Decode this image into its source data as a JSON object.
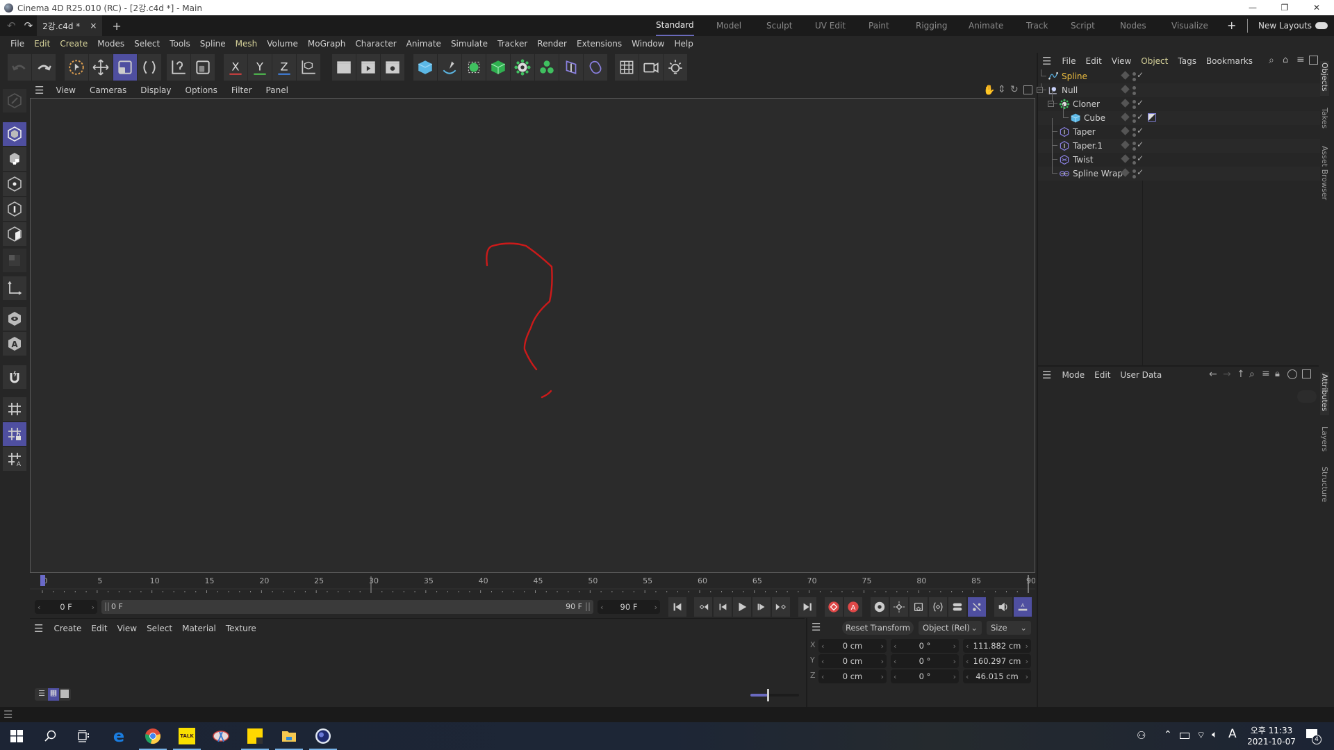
{
  "window": {
    "title": "Cinema 4D R25.010 (RC) - [2강.c4d *] - Main",
    "controls": {
      "minimize": "—",
      "maximize": "❐",
      "close": "✕"
    }
  },
  "tabbar": {
    "undo_icon": "undo-icon",
    "redo_icon": "redo-icon",
    "doc_tab": "2강.c4d *",
    "close": "×",
    "add": "+",
    "layouts": [
      "Standard",
      "Model",
      "Sculpt",
      "UV Edit",
      "Paint",
      "Rigging",
      "Animate",
      "Track",
      "Script",
      "Nodes",
      "Visualize"
    ],
    "active_layout": "Standard",
    "add_layout": "+",
    "new_layouts_label": "New Layouts"
  },
  "menubar": {
    "items": [
      "File",
      "Edit",
      "Create",
      "Modes",
      "Select",
      "Tools",
      "Spline",
      "Mesh",
      "Volume",
      "MoGraph",
      "Character",
      "Animate",
      "Simulate",
      "Tracker",
      "Render",
      "Extensions",
      "Window",
      "Help"
    ]
  },
  "toolbar": {
    "tools": [
      "undo",
      "redo",
      "live-selection",
      "move",
      "scale",
      "rotate",
      "transform-recent",
      "transform",
      "lock-x",
      "lock-y",
      "lock-z",
      "coordinate-system",
      "render-view",
      "render-to-picture-viewer",
      "render-settings",
      "cube",
      "pen",
      "subdivision-surface",
      "extrude",
      "cloner",
      "bend-deformer",
      "floor",
      "camera-bar",
      "grid",
      "camera",
      "light"
    ],
    "axis_labels": {
      "x": "X",
      "y": "Y",
      "z": "Z"
    }
  },
  "viewport": {
    "menu": [
      "View",
      "Cameras",
      "Display",
      "Options",
      "Filter",
      "Panel"
    ],
    "nav_icons": [
      "pan-icon",
      "dolly-icon",
      "orbit-icon",
      "maximize-view-icon"
    ],
    "annotation": "?"
  },
  "timeline": {
    "ticks": [
      "0",
      "5",
      "10",
      "15",
      "20",
      "25",
      "30",
      "35",
      "40",
      "45",
      "50",
      "55",
      "60",
      "65",
      "70",
      "75",
      "80",
      "85",
      "90"
    ],
    "current_frame": "0 F",
    "range_start": "0 F",
    "range_end": "90 F",
    "max_frame": "90 F",
    "playhead_frame": 0
  },
  "objects_panel": {
    "menu": [
      "File",
      "Edit",
      "View",
      "Object",
      "Tags",
      "Bookmarks"
    ],
    "active_menu": "Object",
    "objects": [
      {
        "name": "Spline",
        "icon": "spline-icon",
        "depth": 0,
        "selected": true,
        "check": true
      },
      {
        "name": "Null",
        "icon": "null-icon",
        "depth": 0,
        "selected": false,
        "check": false,
        "expanded": true
      },
      {
        "name": "Cloner",
        "icon": "cloner-icon",
        "depth": 1,
        "selected": false,
        "check": true,
        "expanded": true
      },
      {
        "name": "Cube",
        "icon": "cube-icon",
        "depth": 2,
        "selected": false,
        "check": true,
        "tag": "phong-tag"
      },
      {
        "name": "Taper",
        "icon": "taper-icon",
        "depth": 1,
        "selected": false,
        "check": true
      },
      {
        "name": "Taper.1",
        "icon": "taper-icon",
        "depth": 1,
        "selected": false,
        "check": true
      },
      {
        "name": "Twist",
        "icon": "twist-icon",
        "depth": 1,
        "selected": false,
        "check": true
      },
      {
        "name": "Spline Wrap",
        "icon": "spline-wrap-icon",
        "depth": 1,
        "selected": false,
        "check": true
      }
    ]
  },
  "side_tabs_top": [
    "Objects",
    "Takes",
    "Asset Browser"
  ],
  "side_tabs_bottom": [
    "Attributes",
    "Layers",
    "Structure"
  ],
  "attributes_panel": {
    "menu": [
      "Mode",
      "Edit",
      "User Data"
    ]
  },
  "material_manager": {
    "menu": [
      "Create",
      "Edit",
      "View",
      "Select",
      "Material",
      "Texture"
    ],
    "zoom_slider_value": 0.35
  },
  "coordinates": {
    "reset_label": "Reset Transform",
    "mode_select": "Object (Rel)",
    "size_select": "Size",
    "rows": [
      {
        "axis": "X",
        "pos": "0 cm",
        "rot": "0 °",
        "size": "111.882 cm"
      },
      {
        "axis": "Y",
        "pos": "0 cm",
        "rot": "0 °",
        "size": "160.297 cm"
      },
      {
        "axis": "Z",
        "pos": "0 cm",
        "rot": "0 °",
        "size": "46.015 cm"
      }
    ]
  },
  "taskbar": {
    "apps": [
      "start",
      "search",
      "task-view",
      "edge",
      "chrome",
      "kakaotalk",
      "snipping-tool",
      "sticky-notes",
      "file-explorer",
      "cinema4d"
    ],
    "time": "오후 11:33",
    "date": "2021-10-07",
    "ime": "A",
    "notifications": "4"
  },
  "colors": {
    "accent": "#4f4fa0",
    "selected_object": "#f0c040",
    "menu_highlight": "#d7d39a",
    "annotation_red": "#d01818"
  }
}
